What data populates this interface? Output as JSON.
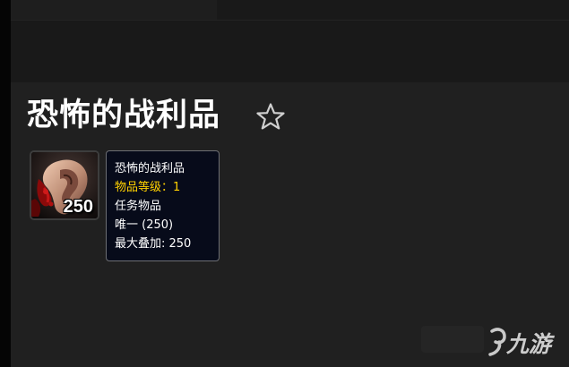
{
  "page": {
    "title": "恐怖的战利品",
    "favorite_icon": "star-outline-icon"
  },
  "item": {
    "icon": "severed-ear-icon",
    "stack_count": "250"
  },
  "tooltip": {
    "name": "恐怖的战利品",
    "item_level": "物品等级：1",
    "type": "任务物品",
    "unique": "唯一 (250)",
    "max_stack": "最大叠加: 250"
  },
  "watermark": {
    "text": "九游",
    "icon": "nine-game-logo-icon"
  },
  "colors": {
    "background": "#202020",
    "top_band": "#191919",
    "tooltip_bg": "#070b1a",
    "tooltip_border": "#6d6f74",
    "item_level": "#ffd100",
    "text": "#ffffff"
  }
}
